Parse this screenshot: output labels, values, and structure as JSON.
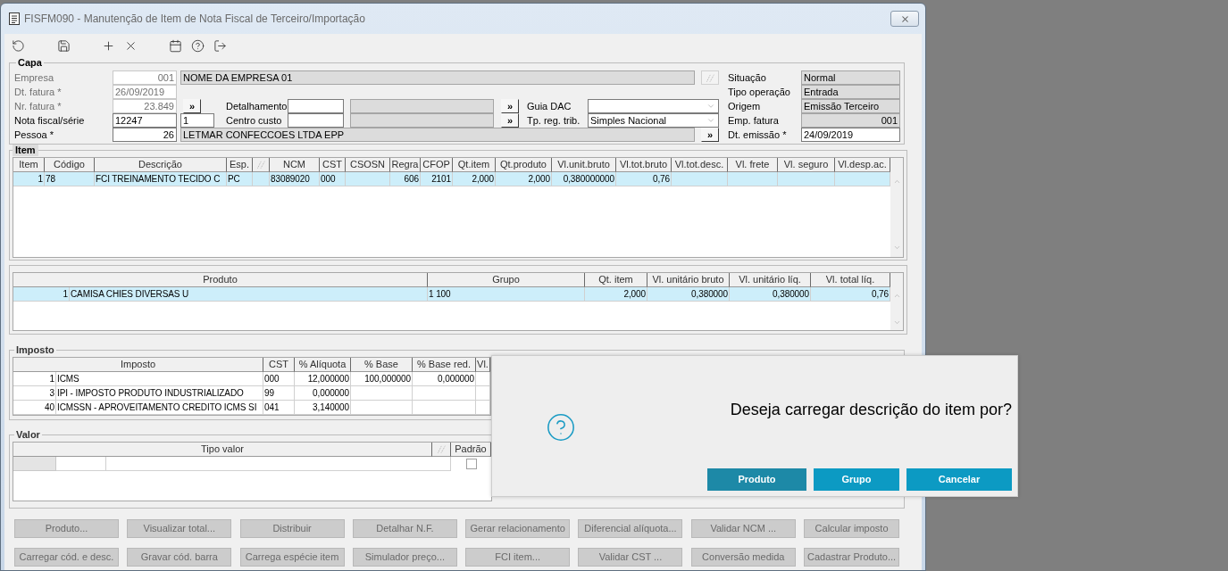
{
  "window": {
    "title": "FISFM090 - Manutenção de Item de Nota Fiscal de Terceiro/Importação"
  },
  "capa": {
    "title": "Capa",
    "empresa": {
      "label": "Empresa",
      "code": "001",
      "name": "NOME DA EMPRESA 01",
      "disabled": true
    },
    "dt_fatura": {
      "label": "Dt. fatura *",
      "value": "26/09/2019",
      "disabled": true
    },
    "nr_fatura": {
      "label": "Nr. fatura *",
      "value": "23.849",
      "disabled": true,
      "button": "»"
    },
    "nota_fiscal": {
      "label": "Nota fiscal/série",
      "number": "12247",
      "serie": "1",
      "disabled": false
    },
    "pessoa": {
      "label": "Pessoa *",
      "code": "26",
      "name": "LETMAR CONFECCOES LTDA EPP",
      "disabled": false,
      "button": "»"
    },
    "detalhamento": {
      "label": "Detalhamento",
      "button": "»"
    },
    "centro_custo": {
      "label": "Centro custo",
      "button": "»"
    },
    "guia_dac": {
      "label": "Guia DAC"
    },
    "tp_reg_trib": {
      "label": "Tp. reg. trib.",
      "value": "Simples Nacional"
    },
    "status": [
      {
        "label": "Situação",
        "value": "Normal",
        "readonly": true
      },
      {
        "label": "Tipo operação",
        "value": "Entrada",
        "readonly": true
      },
      {
        "label": "Origem",
        "value": "Emissão Terceiro",
        "readonly": true
      },
      {
        "label": "Emp. fatura",
        "value": "001",
        "readonly": true
      },
      {
        "label": "Dt. emissão *",
        "value": "24/09/2019",
        "readonly": false
      }
    ]
  },
  "item": {
    "title": "Item",
    "columns": [
      {
        "kind": "text",
        "label": "Item"
      },
      {
        "kind": "text",
        "label": "Código"
      },
      {
        "kind": "text",
        "label": "Descrição"
      },
      {
        "kind": "text",
        "label": "Esp."
      },
      {
        "kind": "icon"
      },
      {
        "kind": "text",
        "label": "NCM"
      },
      {
        "kind": "text",
        "label": "CST"
      },
      {
        "kind": "text",
        "label": "CSOSN"
      },
      {
        "kind": "text",
        "label": "Regra"
      },
      {
        "kind": "text",
        "label": "CFOP"
      },
      {
        "kind": "text",
        "label": "Qt.item"
      },
      {
        "kind": "text",
        "label": "Qt.produto"
      },
      {
        "kind": "text",
        "label": "Vl.unit.bruto"
      },
      {
        "kind": "text",
        "label": "Vl.tot.bruto"
      },
      {
        "kind": "text",
        "label": "Vl.tot.desc."
      },
      {
        "kind": "text",
        "label": "Vl. frete"
      },
      {
        "kind": "text",
        "label": "Vl. seguro"
      },
      {
        "kind": "text",
        "label": "Vl.desp.ac."
      }
    ],
    "rows": [
      {
        "selected": true,
        "cells": [
          "1",
          "78",
          "FCI TREINAMENTO TECIDO C",
          "PC",
          null,
          "83089020",
          "000",
          null,
          "606",
          "2101",
          "2,000",
          "2,000",
          "0,380000000",
          "0,76",
          null,
          null,
          null,
          null
        ]
      }
    ]
  },
  "produtos": {
    "columns": [
      "Produto",
      "Grupo",
      "Qt. item",
      "Vl. unitário bruto",
      "Vl. unitário líq.",
      "Vl. total líq."
    ],
    "rows": [
      {
        "selected": true,
        "number": "1",
        "cells": [
          "CAMISA CHIES DIVERSAS U",
          "1 100",
          "2,000",
          "0,380000",
          "0,380000",
          "0,76"
        ]
      }
    ]
  },
  "imposto": {
    "title": "Imposto",
    "columns": [
      "Imposto",
      "CST",
      "% Alíquota",
      "% Base",
      "% Base red.",
      "Vl."
    ],
    "rows": [
      {
        "selected": false,
        "number": "1",
        "cells": [
          "ICMS",
          "000",
          "12,000000",
          "100,000000",
          "0,000000",
          null
        ]
      },
      {
        "selected": false,
        "number": "3",
        "cells": [
          "IPI - IMPOSTO PRODUTO INDUSTRIALIZADO",
          "99",
          "0,000000",
          null,
          null,
          null
        ]
      },
      {
        "selected": false,
        "number": "40",
        "cells": [
          "ICMSSN - APROVEITAMENTO CREDITO ICMS SI",
          "041",
          "3,140000",
          null,
          null,
          null
        ]
      }
    ]
  },
  "valor": {
    "title": "Valor",
    "columns": [
      {
        "kind": "text",
        "label": "Tipo valor"
      },
      {
        "kind": "icon"
      },
      {
        "kind": "text",
        "label": "Padrão"
      }
    ],
    "rows": [
      {
        "checked": false
      }
    ]
  },
  "actions": [
    {
      "label": "Produto...",
      "disabled": true
    },
    {
      "label": "Visualizar total...",
      "disabled": true
    },
    {
      "label": "Distribuir",
      "disabled": true
    },
    {
      "label": "Detalhar N.F.",
      "disabled": true
    },
    {
      "label": "Gerar relacionamento",
      "disabled": true
    },
    {
      "label": "Diferencial alíquota...",
      "disabled": true
    },
    {
      "label": "Validar NCM ...",
      "disabled": true
    },
    {
      "label": "Calcular imposto",
      "disabled": true
    },
    {
      "label": "Carregar cód. e desc.",
      "disabled": true
    },
    {
      "label": "Gravar cód. barra",
      "disabled": true
    },
    {
      "label": "Carrega espécie item",
      "disabled": true
    },
    {
      "label": "Simulador preço...",
      "disabled": true
    },
    {
      "label": "FCI item...",
      "disabled": true
    },
    {
      "label": "Validar CST ...",
      "disabled": true
    },
    {
      "label": "Conversão medida",
      "disabled": true
    },
    {
      "label": "Cadastrar Produto...",
      "disabled": true
    }
  ],
  "dialog": {
    "message": "Deseja carregar descrição do item por?",
    "buttons": [
      {
        "label": "Produto",
        "focused": true
      },
      {
        "label": "Grupo",
        "focused": false
      },
      {
        "label": "Cancelar",
        "focused": false
      }
    ]
  }
}
